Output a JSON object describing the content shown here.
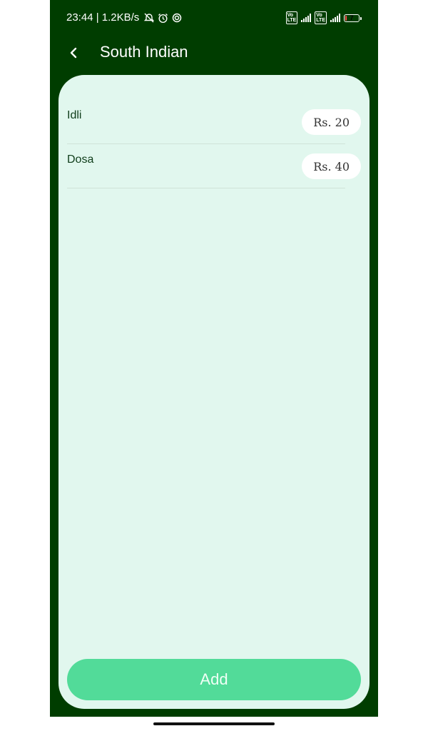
{
  "status_bar": {
    "time_speed": "23:44 | 1.2KB/s",
    "battery_level": "7",
    "battery_fraction": 0.07,
    "icons": [
      "mute-icon",
      "alarm-icon",
      "sync-icon",
      "volte-icon",
      "signal-icon",
      "volte-icon",
      "signal-4g-icon",
      "battery-icon"
    ]
  },
  "app_bar": {
    "title": "South Indian"
  },
  "items": [
    {
      "name": "Idli",
      "price": "Rs. 20"
    },
    {
      "name": "Dosa",
      "price": "Rs. 40"
    }
  ],
  "add_button": {
    "label": "Add"
  },
  "colors": {
    "header_bg": "#003d00",
    "card_bg": "#e1f7ee",
    "accent": "#52db99"
  }
}
